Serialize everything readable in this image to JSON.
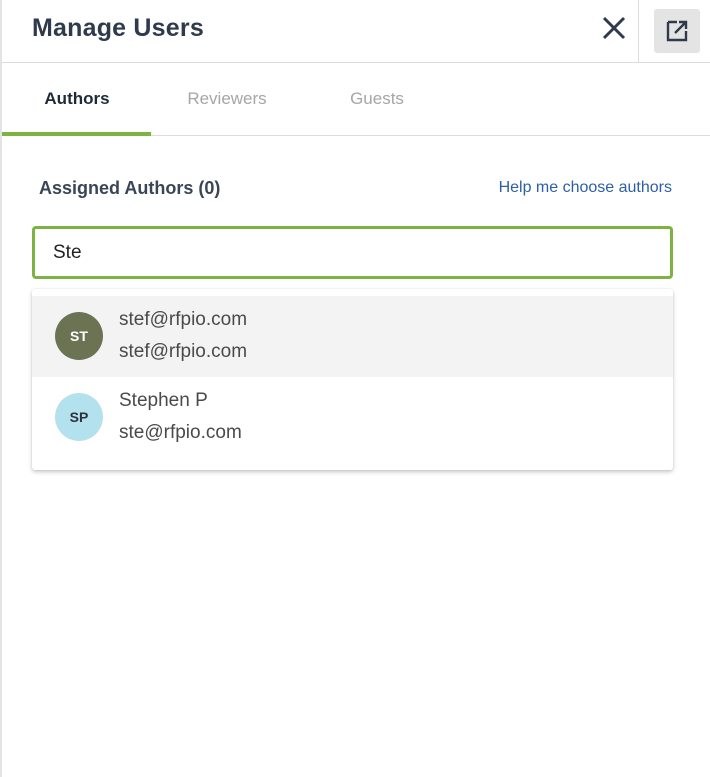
{
  "header": {
    "title": "Manage Users",
    "close_icon": "close-icon",
    "popout_icon": "open-in-new-icon"
  },
  "tabs": [
    {
      "label": "Authors",
      "active": true
    },
    {
      "label": "Reviewers",
      "active": false
    },
    {
      "label": "Guests",
      "active": false
    }
  ],
  "assigned": {
    "title": "Assigned Authors (0)",
    "help_link": "Help me choose authors"
  },
  "search": {
    "value": "Ste"
  },
  "suggestions": [
    {
      "initials": "ST",
      "name": "stef@rfpio.com",
      "email": "stef@rfpio.com",
      "avatar_color": "#6b7353",
      "highlighted": true
    },
    {
      "initials": "SP",
      "name": "Stephen P",
      "email": "ste@rfpio.com",
      "avatar_color": "#b4e1ee",
      "highlighted": false
    }
  ],
  "colors": {
    "accent": "#7cb342",
    "link": "#2d5fa7"
  }
}
